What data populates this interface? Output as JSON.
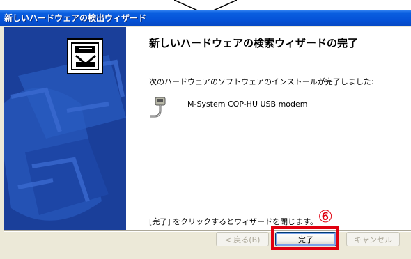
{
  "window": {
    "title": "新しいハードウェアの検出ウィザード"
  },
  "content": {
    "heading": "新しいハードウェアの検索ウィザードの完了",
    "intro": "次のハードウェアのソフトウェアのインストールが完了しました:",
    "device_name": "M-System COP-HU USB modem",
    "finish_hint": "[完了] をクリックするとウィザードを閉じます。"
  },
  "buttons": {
    "back_label": "< 戻る(B)",
    "finish_label": "完了",
    "cancel_label": "キャンセル"
  },
  "annotation": {
    "step_number": "⑥"
  },
  "colors": {
    "titlebar": "#0553d8",
    "wizard_panel": "#1a3f9a",
    "dialog_face": "#ece9d8",
    "highlight": "#e0000f"
  },
  "icons": [
    "wizard-hardware-icon",
    "modem-device-icon",
    "down-arrow-icon"
  ]
}
